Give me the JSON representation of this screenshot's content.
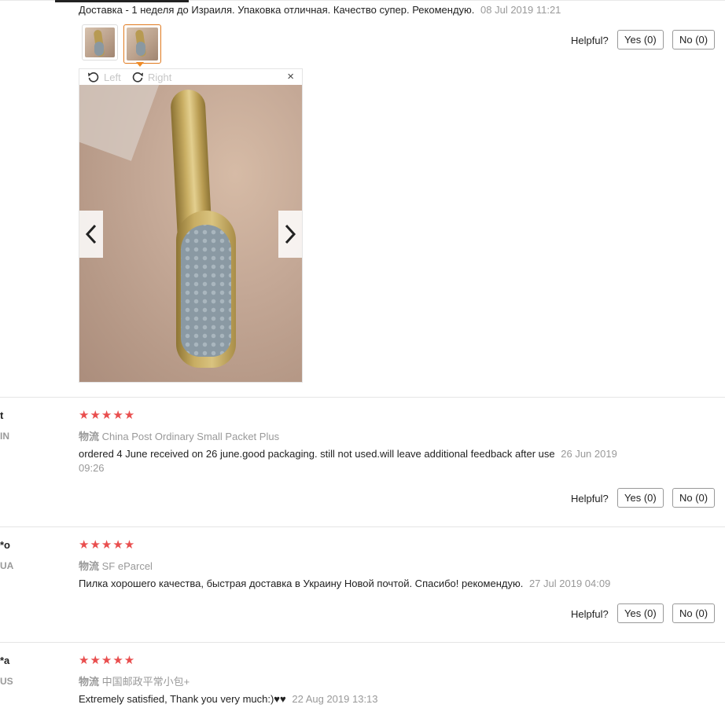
{
  "review1": {
    "text": "Доставка - 1 неделя до Израиля. Упаковка отличная. Качество супер. Рекомендую.",
    "date": "08 Jul 2019 11:21",
    "viewer": {
      "left_label": "Left",
      "right_label": "Right",
      "close_glyph": "×"
    },
    "helpful_label": "Helpful?",
    "yes_label": "Yes (0)",
    "no_label": "No (0)"
  },
  "review2": {
    "user": "t",
    "country": "IN",
    "stars": "★★★★★",
    "logistics_label": "物流",
    "logistics": "China Post Ordinary Small Packet Plus",
    "text": "ordered 4 June received on 26 june.good packaging. still not used.will leave additional feedback after use",
    "date_part1": "26 Jun 2019",
    "date_part2": "09:26",
    "helpful_label": "Helpful?",
    "yes_label": "Yes (0)",
    "no_label": "No (0)"
  },
  "review3": {
    "user": "*o",
    "country": "UA",
    "stars": "★★★★★",
    "logistics_label": "物流",
    "logistics": "SF eParcel",
    "text": "Пилка хорошего качества, быстрая доставка в Украину Новой почтой. Спасибо! рекомендую.",
    "date": "27 Jul 2019 04:09",
    "helpful_label": "Helpful?",
    "yes_label": "Yes (0)",
    "no_label": "No (0)"
  },
  "review4": {
    "user": "*a",
    "country": "US",
    "stars": "★★★★★",
    "logistics_label": "物流",
    "logistics": "中国邮政平常小包+",
    "text": "Extremely satisfied, Thank you very much:)♥♥",
    "date": "22 Aug 2019 13:13"
  },
  "colors": {
    "star": "#e94e4e",
    "active_thumb_border": "#e0791d",
    "muted_text": "#999999"
  },
  "icons": [
    "rotate-left-icon",
    "rotate-right-icon",
    "close-icon",
    "chevron-left-icon",
    "chevron-right-icon",
    "star-icon"
  ]
}
